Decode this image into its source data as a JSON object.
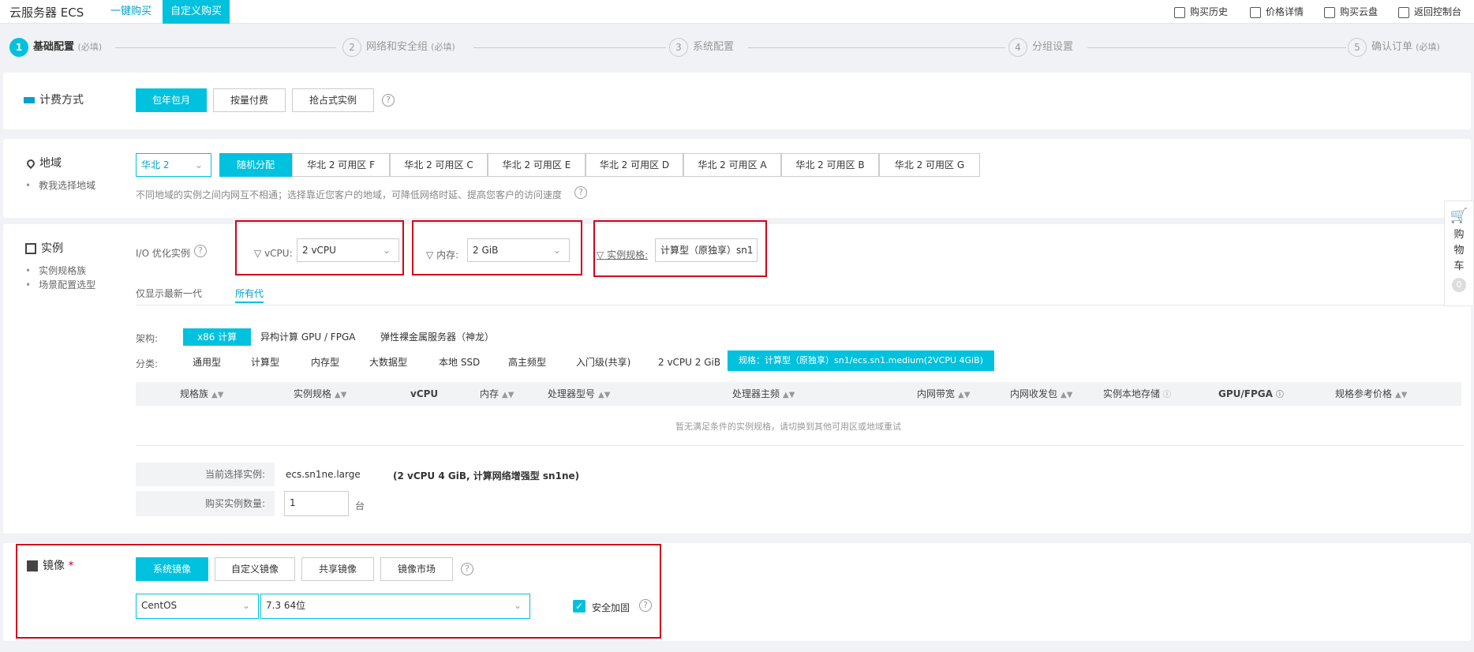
{
  "header": {
    "brand": "云服务器 ECS",
    "tabs": [
      {
        "label": "一键购买"
      },
      {
        "label": "自定义购买"
      }
    ],
    "links": [
      {
        "label": "购买历史"
      },
      {
        "label": "价格详情"
      },
      {
        "label": "购买云盘"
      },
      {
        "label": "返回控制台"
      }
    ]
  },
  "steps": [
    {
      "num": "1",
      "label": "基础配置",
      "note": "(必填)"
    },
    {
      "num": "2",
      "label": "网络和安全组",
      "note": "(必填)"
    },
    {
      "num": "3",
      "label": "系统配置",
      "note": ""
    },
    {
      "num": "4",
      "label": "分组设置",
      "note": ""
    },
    {
      "num": "5",
      "label": "确认订单",
      "note": "(必填)"
    }
  ],
  "billing": {
    "title": "计费方式",
    "options": [
      {
        "label": "包年包月"
      },
      {
        "label": "按量付费"
      },
      {
        "label": "抢占式实例"
      }
    ]
  },
  "region": {
    "title": "地域",
    "link": "教我选择地域",
    "selected": "华北 2",
    "zones": [
      {
        "label": "随机分配"
      },
      {
        "label": "华北 2 可用区 F"
      },
      {
        "label": "华北 2 可用区 C"
      },
      {
        "label": "华北 2 可用区 E"
      },
      {
        "label": "华北 2 可用区 D"
      },
      {
        "label": "华北 2 可用区 A"
      },
      {
        "label": "华北 2 可用区 B"
      },
      {
        "label": "华北 2 可用区 G"
      }
    ],
    "hint": "不同地域的实例之间内网互不相通；选择靠近您客户的地域，可降低网络时延、提高您客户的访问速度"
  },
  "instance": {
    "title": "实例",
    "links": [
      "实例规格族",
      "场景配置选型"
    ],
    "io_label": "I/O 优化实例",
    "filters": {
      "vcpu_label": "vCPU:",
      "vcpu_value": "2 vCPU",
      "mem_label": "内存:",
      "mem_value": "2 GiB",
      "spec_label": "实例规格:",
      "spec_value": "计算型（原独享）sn1"
    },
    "gen_tabs": [
      {
        "label": "仅显示最新一代"
      },
      {
        "label": "所有代"
      }
    ],
    "arch_label": "架构:",
    "arch": [
      {
        "label": "x86 计算"
      },
      {
        "label": "异构计算 GPU / FPGA"
      },
      {
        "label": "弹性裸金属服务器（神龙）"
      }
    ],
    "cat_label": "分类:",
    "categories": [
      {
        "label": "通用型"
      },
      {
        "label": "计算型"
      },
      {
        "label": "内存型"
      },
      {
        "label": "大数据型"
      },
      {
        "label": "本地 SSD"
      },
      {
        "label": "高主频型"
      },
      {
        "label": "入门级(共享)"
      },
      {
        "label": "2 vCPU 2 GiB"
      },
      {
        "label": "规格：计算型（原独享）sn1/ecs.sn1.medium(2VCPU 4GiB)"
      }
    ],
    "columns": [
      {
        "label": "规格族"
      },
      {
        "label": "实例规格"
      },
      {
        "label": "vCPU"
      },
      {
        "label": "内存"
      },
      {
        "label": "处理器型号"
      },
      {
        "label": "处理器主频"
      },
      {
        "label": "内网带宽"
      },
      {
        "label": "内网收发包"
      },
      {
        "label": "实例本地存储"
      },
      {
        "label": "GPU/FPGA"
      },
      {
        "label": "规格参考价格"
      }
    ],
    "empty": "暂无满足条件的实例规格，请切换到其他可用区或地域重试",
    "current_label": "当前选择实例:",
    "current_value": "ecs.sn1ne.large",
    "current_desc": "(2 vCPU 4 GiB, 计算网络增强型 sn1ne)",
    "qty_label": "购买实例数量:",
    "qty_value": "1",
    "qty_unit": "台"
  },
  "image": {
    "title": "镜像",
    "required": "*",
    "tabs": [
      {
        "label": "系统镜像"
      },
      {
        "label": "自定义镜像"
      },
      {
        "label": "共享镜像"
      },
      {
        "label": "镜像市场"
      }
    ],
    "os": "CentOS",
    "version": "7.3 64位",
    "security": "安全加固"
  },
  "cart": {
    "label": "购物车",
    "chars": [
      "购",
      "物",
      "车"
    ],
    "count": "0"
  },
  "colors": {
    "accent": "#00c1de",
    "highlight": "#d0021b"
  }
}
